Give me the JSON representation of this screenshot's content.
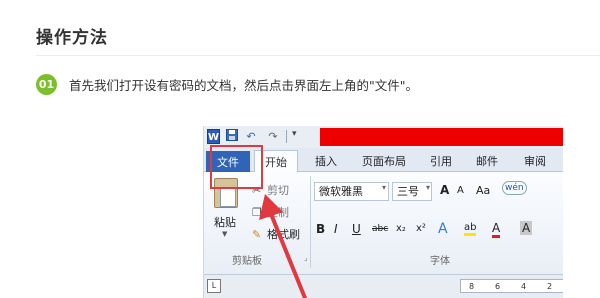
{
  "header": {
    "title": "操作方法"
  },
  "step": {
    "number": "01",
    "text": "首先我们打开设有密码的文档，然后点击界面左上角的\"文件\"。"
  },
  "word": {
    "qat": {
      "app_icon": "W",
      "save_icon": "save-icon",
      "undo_icon": "↶",
      "redo_icon": "↷",
      "more_icon": "▾"
    },
    "tabs": {
      "file": "文件",
      "home": "开始",
      "insert": "插入",
      "layout": "页面布局",
      "references": "引用",
      "mailings": "邮件",
      "review": "审阅"
    },
    "clipboard": {
      "paste": "粘贴",
      "cut": "剪切",
      "copy": "复制",
      "format_painter": "格式刷",
      "group_label": "剪贴板"
    },
    "font": {
      "font_name": "微软雅黑",
      "font_size": "三号",
      "grow": "A",
      "shrink": "A",
      "change_case": "Aa",
      "phonetic": "wén",
      "bold": "B",
      "italic": "I",
      "underline": "U",
      "strike": "abc",
      "subscript": "x₂",
      "superscript": "x²",
      "text_effects": "A",
      "highlight": "ab",
      "font_color": "A",
      "char_shading": "A",
      "group_label": "字体"
    },
    "ruler": {
      "corner": "L",
      "marks": [
        "8",
        "6",
        "4",
        "2"
      ]
    },
    "colors": {
      "accent_red": "#ee0000",
      "file_tab": "#2f64b6",
      "step_badge": "#7bbf2a",
      "callout": "#e0393f"
    }
  }
}
